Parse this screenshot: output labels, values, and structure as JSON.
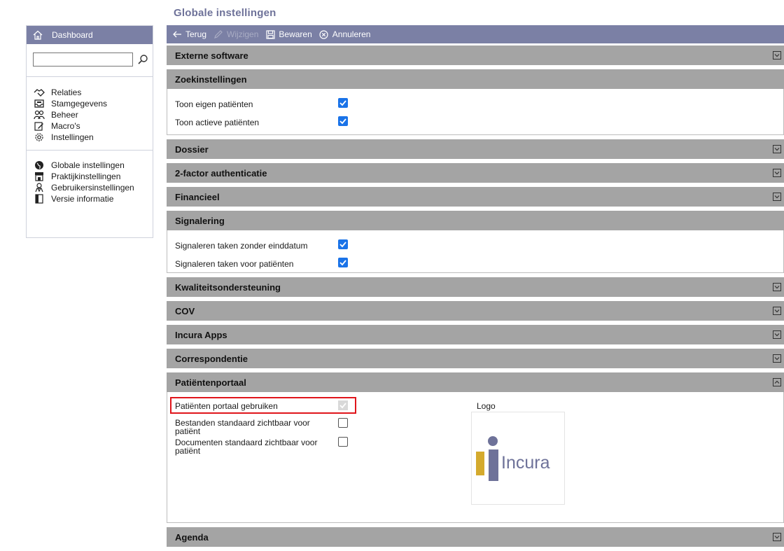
{
  "page": {
    "title": "Globale instellingen"
  },
  "sidebar": {
    "header": "Dashboard",
    "search": {
      "value": "",
      "placeholder": ""
    },
    "group1": [
      {
        "label": "Relaties",
        "icon": "handshake-icon"
      },
      {
        "label": "Stamgegevens",
        "icon": "inbox-icon"
      },
      {
        "label": "Beheer",
        "icon": "users-icon"
      },
      {
        "label": "Macro's",
        "icon": "macro-icon"
      },
      {
        "label": "Instellingen",
        "icon": "gear-icon"
      }
    ],
    "group2": [
      {
        "label": "Globale instellingen",
        "icon": "globe-icon"
      },
      {
        "label": "Praktijkinstellingen",
        "icon": "store-icon"
      },
      {
        "label": "Gebruikersinstellingen",
        "icon": "user-badge-icon"
      },
      {
        "label": "Versie informatie",
        "icon": "book-icon"
      }
    ]
  },
  "toolbar": {
    "back": "Terug",
    "edit": "Wijzigen",
    "save": "Bewaren",
    "cancel": "Annuleren"
  },
  "sections": {
    "externe": {
      "title": "Externe software"
    },
    "zoek": {
      "title": "Zoekinstellingen",
      "rows": [
        {
          "label": "Toon eigen patiënten",
          "checked": true
        },
        {
          "label": "Toon actieve patiënten",
          "checked": true
        }
      ]
    },
    "dossier": {
      "title": "Dossier"
    },
    "twofactor": {
      "title": "2-factor authenticatie"
    },
    "financieel": {
      "title": "Financieel"
    },
    "signalering": {
      "title": "Signalering",
      "rows": [
        {
          "label": "Signaleren taken zonder einddatum",
          "checked": true
        },
        {
          "label": "Signaleren taken voor patiënten",
          "checked": true
        }
      ]
    },
    "kwaliteit": {
      "title": "Kwaliteitsondersteuning"
    },
    "cov": {
      "title": "COV"
    },
    "apps": {
      "title": "Incura Apps"
    },
    "correspondentie": {
      "title": "Correspondentie"
    },
    "portaal": {
      "title": "Patiëntenportaal",
      "rows": [
        {
          "label": "Patiënten portaal gebruiken",
          "checked": true,
          "disabled": true
        },
        {
          "label": "Bestanden standaard zichtbaar voor patiënt",
          "checked": false
        },
        {
          "label": "Documenten standaard zichtbaar voor patiënt",
          "checked": false
        }
      ],
      "logo_label": "Logo",
      "logo_text": "Incura"
    },
    "agenda": {
      "title": "Agenda"
    }
  },
  "colors": {
    "header_bar": "#7b80a5",
    "section_header": "#a4a4a4",
    "checkbox_checked": "#1a73e8",
    "highlight": "#e0151b",
    "logo_gold": "#d4aa2d",
    "logo_purple": "#6e7299"
  }
}
